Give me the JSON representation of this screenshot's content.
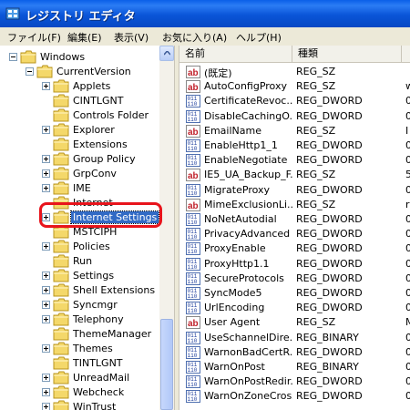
{
  "window": {
    "title": "レジストリ エディタ"
  },
  "menu": [
    "ファイル(F)",
    "編集(E)",
    "表示(V)",
    "お気に入り(A)",
    "ヘルプ(H)"
  ],
  "tree": {
    "nodes": [
      {
        "label": "Windows",
        "expander": "minus",
        "level": 0
      },
      {
        "label": "CurrentVersion",
        "expander": "minus",
        "level": 1
      },
      {
        "label": "Applets",
        "expander": "plus",
        "level": 2
      },
      {
        "label": "CINTLGNT",
        "expander": "none",
        "level": 2
      },
      {
        "label": "Controls Folder",
        "expander": "none",
        "level": 2
      },
      {
        "label": "Explorer",
        "expander": "plus",
        "level": 2
      },
      {
        "label": "Extensions",
        "expander": "none",
        "level": 2
      },
      {
        "label": "Group Policy",
        "expander": "plus",
        "level": 2
      },
      {
        "label": "GrpConv",
        "expander": "plus",
        "level": 2
      },
      {
        "label": "IME",
        "expander": "plus",
        "level": 2
      },
      {
        "label": "Internet",
        "expander": "none",
        "level": 2
      },
      {
        "label": "Internet Settings",
        "expander": "plus",
        "level": 2,
        "selected": true
      },
      {
        "label": "MSTCIPH",
        "expander": "none",
        "level": 2
      },
      {
        "label": "Policies",
        "expander": "plus",
        "level": 2
      },
      {
        "label": "Run",
        "expander": "none",
        "level": 2
      },
      {
        "label": "Settings",
        "expander": "plus",
        "level": 2
      },
      {
        "label": "Shell Extensions",
        "expander": "plus",
        "level": 2
      },
      {
        "label": "Syncmgr",
        "expander": "plus",
        "level": 2
      },
      {
        "label": "Telephony",
        "expander": "plus",
        "level": 2
      },
      {
        "label": "ThemeManager",
        "expander": "none",
        "level": 2
      },
      {
        "label": "Themes",
        "expander": "plus",
        "level": 2
      },
      {
        "label": "TINTLGNT",
        "expander": "none",
        "level": 2
      },
      {
        "label": "UnreadMail",
        "expander": "plus",
        "level": 2
      },
      {
        "label": "Webcheck",
        "expander": "plus",
        "level": 2
      },
      {
        "label": "WinTrust",
        "expander": "plus",
        "level": 2
      }
    ]
  },
  "list": {
    "columns": [
      "名前",
      "種類"
    ],
    "rows": [
      {
        "icon": "ab",
        "name": "(既定)",
        "type": "REG_SZ",
        "data": ""
      },
      {
        "icon": "ab",
        "name": "AutoConfigProxy",
        "type": "REG_SZ",
        "data": "w"
      },
      {
        "icon": "bin",
        "name": "CertificateRevoc...",
        "type": "REG_DWORD",
        "data": "0"
      },
      {
        "icon": "bin",
        "name": "DisableCachingO...",
        "type": "REG_DWORD",
        "data": "0"
      },
      {
        "icon": "ab",
        "name": "EmailName",
        "type": "REG_SZ",
        "data": "I"
      },
      {
        "icon": "bin",
        "name": "EnableHttp1_1",
        "type": "REG_DWORD",
        "data": "0"
      },
      {
        "icon": "bin",
        "name": "EnableNegotiate",
        "type": "REG_DWORD",
        "data": "0"
      },
      {
        "icon": "ab",
        "name": "IE5_UA_Backup_F...",
        "type": "REG_SZ",
        "data": "5"
      },
      {
        "icon": "bin",
        "name": "MigrateProxy",
        "type": "REG_DWORD",
        "data": "0"
      },
      {
        "icon": "ab",
        "name": "MimeExclusionLi...",
        "type": "REG_SZ",
        "data": "r"
      },
      {
        "icon": "bin",
        "name": "NoNetAutodial",
        "type": "REG_DWORD",
        "data": "0"
      },
      {
        "icon": "bin",
        "name": "PrivacyAdvanced",
        "type": "REG_DWORD",
        "data": "0"
      },
      {
        "icon": "bin",
        "name": "ProxyEnable",
        "type": "REG_DWORD",
        "data": "0"
      },
      {
        "icon": "bin",
        "name": "ProxyHttp1.1",
        "type": "REG_DWORD",
        "data": "0"
      },
      {
        "icon": "bin",
        "name": "SecureProtocols",
        "type": "REG_DWORD",
        "data": "0"
      },
      {
        "icon": "bin",
        "name": "SyncMode5",
        "type": "REG_DWORD",
        "data": "0"
      },
      {
        "icon": "bin",
        "name": "UrlEncoding",
        "type": "REG_DWORD",
        "data": "0"
      },
      {
        "icon": "ab",
        "name": "User Agent",
        "type": "REG_SZ",
        "data": "M"
      },
      {
        "icon": "bin",
        "name": "UseSchannelDire...",
        "type": "REG_BINARY",
        "data": "0"
      },
      {
        "icon": "bin",
        "name": "WarnonBadCertR...",
        "type": "REG_DWORD",
        "data": "0"
      },
      {
        "icon": "bin",
        "name": "WarnOnPost",
        "type": "REG_BINARY",
        "data": "0"
      },
      {
        "icon": "bin",
        "name": "WarnOnPostRedir...",
        "type": "REG_DWORD",
        "data": "0"
      },
      {
        "icon": "bin",
        "name": "WarnOnZoneCross...",
        "type": "REG_DWORD",
        "data": "0"
      }
    ]
  },
  "colors": {
    "titlebar": "#0a55d8",
    "selection": "#316ac5",
    "highlight_box": "#e8141c",
    "folder": "#f4d86a"
  }
}
